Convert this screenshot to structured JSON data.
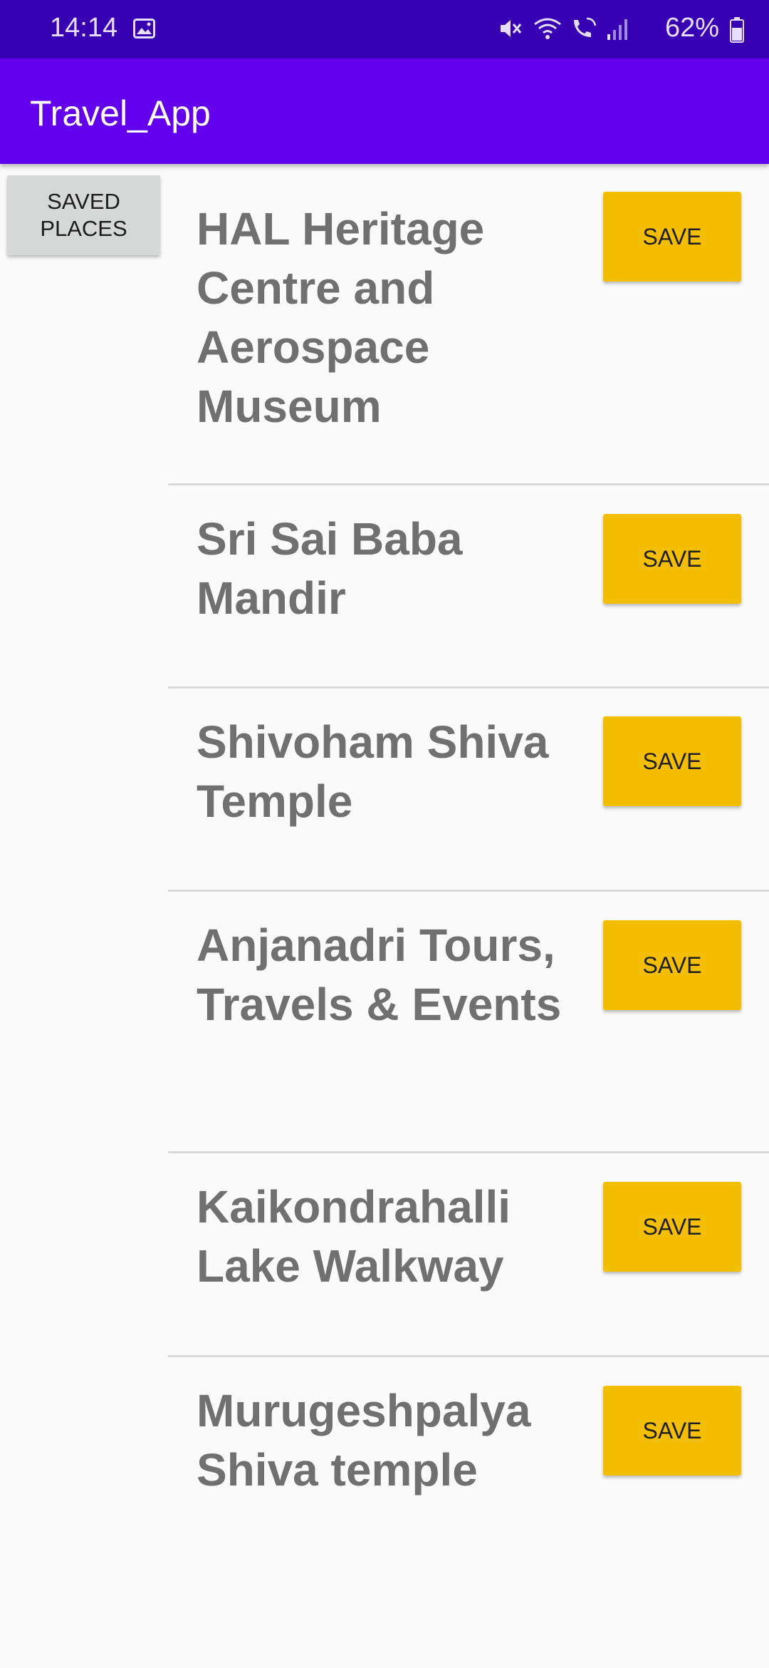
{
  "status_bar": {
    "time": "14:14",
    "battery": "62%",
    "icons": [
      "gallery-icon",
      "mute-icon",
      "wifi-icon",
      "wifi-calling-icon",
      "signal-icon",
      "battery-icon"
    ]
  },
  "app_bar": {
    "title": "Travel_App",
    "color": "#6200ee"
  },
  "saved_places_button": {
    "line1": "SAVED",
    "line2": "PLACES"
  },
  "places": [
    {
      "name": "HAL Heritage Centre and Aerospace Museum",
      "save_label": "SAVE"
    },
    {
      "name": "Sri Sai Baba Mandir",
      "save_label": "SAVE"
    },
    {
      "name": "Shivoham Shiva Temple",
      "save_label": "SAVE"
    },
    {
      "name": "Anjanadri Tours, Travels & Events",
      "save_label": "SAVE"
    },
    {
      "name": "Kaikondrahalli Lake Walkway",
      "save_label": "SAVE"
    },
    {
      "name": "Murugeshpalya Shiva temple",
      "save_label": "SAVE"
    }
  ],
  "colors": {
    "status_bar": "#3700b3",
    "save_button": "#f4bf03",
    "saved_places_button": "#d6d7d7"
  }
}
